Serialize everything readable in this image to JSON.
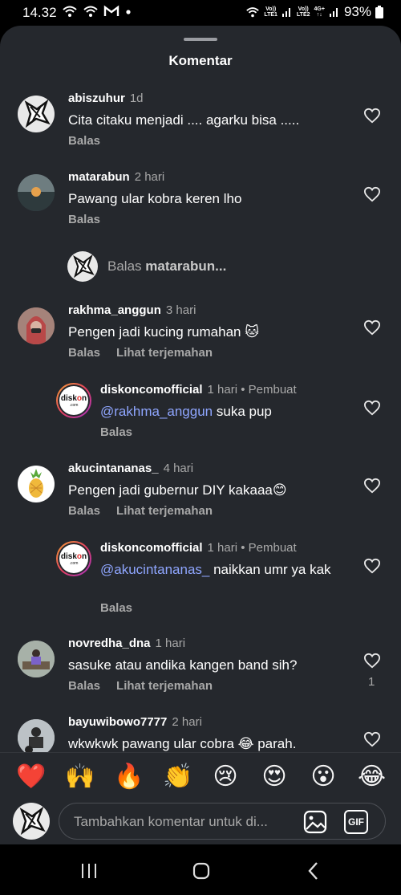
{
  "status": {
    "time": "14.32",
    "battery": "93%",
    "sim1_top": "Vo))",
    "sim1_bottom": "LTE1",
    "sim2_top": "Vo))",
    "sim2_bottom": "LTE2",
    "net": "4G+"
  },
  "sheet": {
    "title": "Komentar"
  },
  "comments": [
    {
      "username": "abiszuhur",
      "time": "1d",
      "text": "Cita citaku menjadi .... agarku bisa .....",
      "reply_label": "Balas"
    },
    {
      "username": "matarabun",
      "time": "2 hari",
      "text": "Pawang ular kobra keren lho",
      "reply_label": "Balas"
    },
    {
      "username": "rakhma_anggun",
      "time": "3 hari",
      "text": "Pengen jadi kucing rumahan 🐱",
      "reply_label": "Balas",
      "translate_label": "Lihat terjemahan"
    },
    {
      "username": "diskoncomofficial",
      "time": "1 hari",
      "creator_label": "• Pembuat",
      "mention": "@rakhma_anggun",
      "text": " suka pup",
      "reply_label": "Balas"
    },
    {
      "username": "akucintananas_",
      "time": "4 hari",
      "text": "Pengen jadi gubernur DIY kakaaa😊",
      "reply_label": "Balas",
      "translate_label": "Lihat terjemahan"
    },
    {
      "username": "diskoncomofficial",
      "time": "1 hari",
      "creator_label": "• Pembuat",
      "mention": "@akucintananas_",
      "text": " naikkan umr ya kak",
      "reply_label": "Balas"
    },
    {
      "username": "novredha_dna",
      "time": "1 hari",
      "text": "sasuke atau andika kangen band sih?",
      "reply_label": "Balas",
      "translate_label": "Lihat terjemahan",
      "likes": "1"
    },
    {
      "username": "bayuwibowo7777",
      "time": "2 hari",
      "text": "wkwkwk pawang ular cobra 😂 parah."
    }
  ],
  "reply_prompt": {
    "prefix": "Balas ",
    "target": "matarabun..."
  },
  "emoji_bar": [
    "❤️",
    "🙌",
    "🔥",
    "👏",
    "😢",
    "😍",
    "😮",
    "😂"
  ],
  "composer": {
    "placeholder": "Tambahkan komentar untuk di...",
    "gif_label": "GIF"
  },
  "brand": {
    "logo_text_1": "disk",
    "logo_text_2": "n",
    "logo_sub": ".com"
  }
}
